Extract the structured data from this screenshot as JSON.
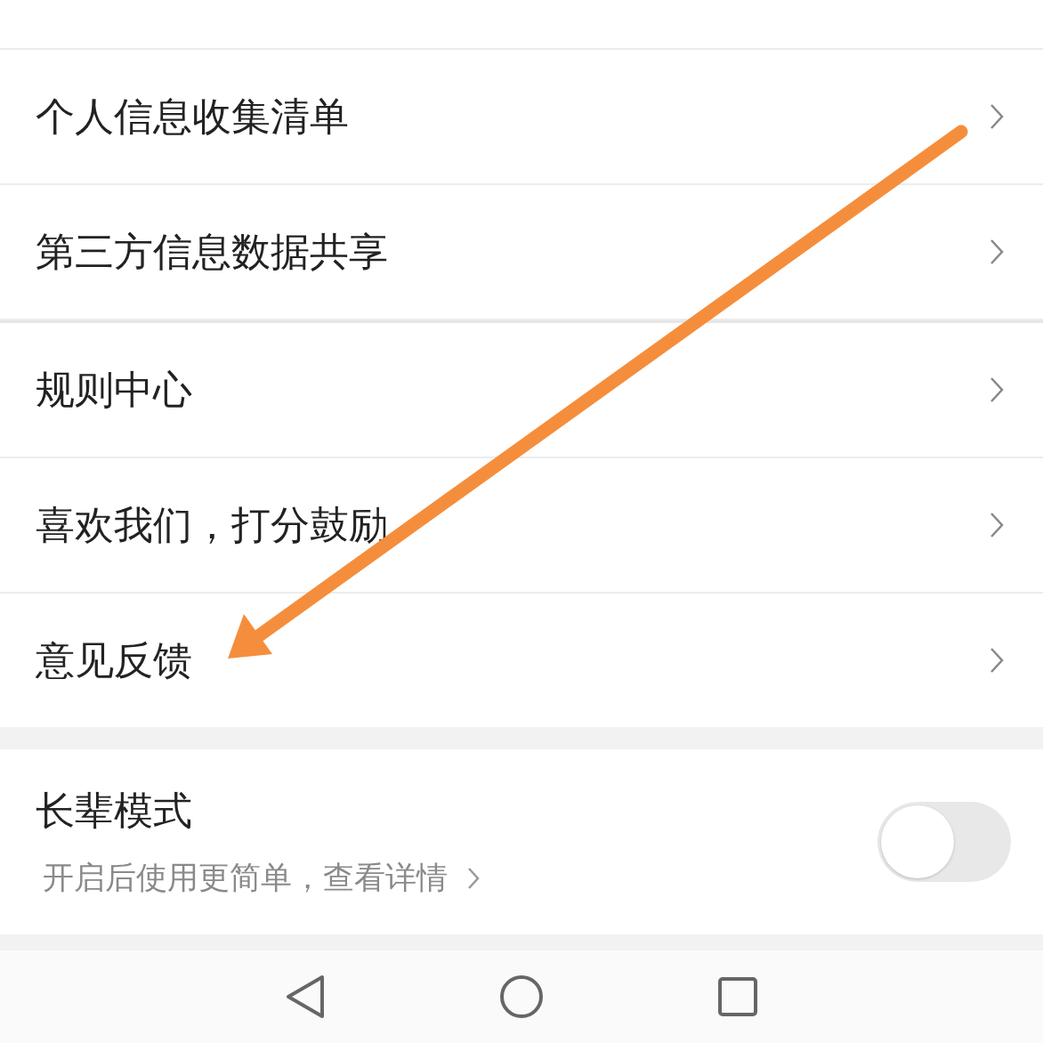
{
  "menu_items": [
    {
      "label": "个人信息收集清单"
    },
    {
      "label": "第三方信息数据共享"
    },
    {
      "label": "规则中心"
    },
    {
      "label": "喜欢我们，打分鼓励"
    },
    {
      "label": "意见反馈"
    }
  ],
  "elder_mode": {
    "title": "长辈模式",
    "description": "开启后使用更简单，查看详情",
    "on": false
  }
}
